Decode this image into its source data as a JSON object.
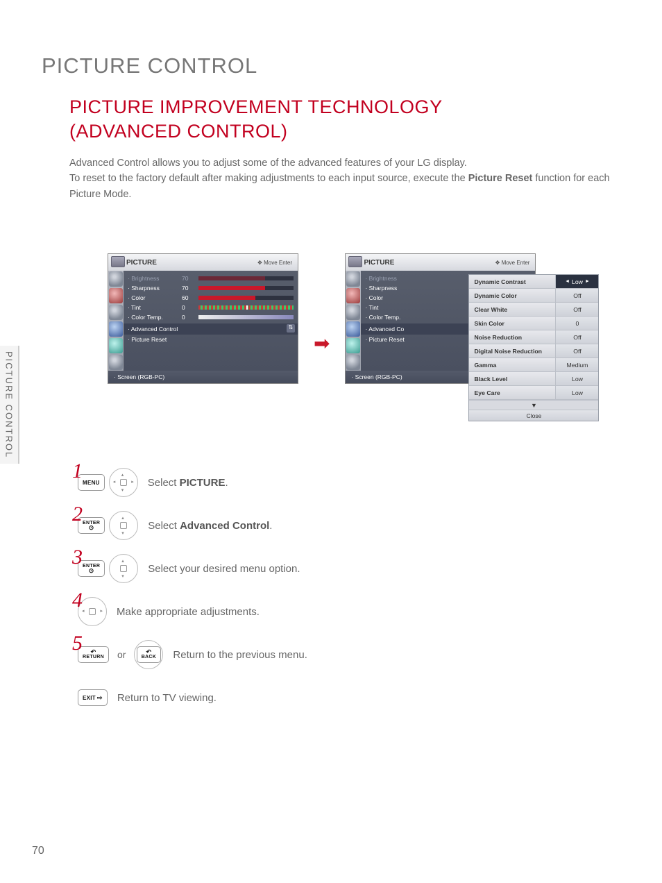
{
  "sideTab": "PICTURE CONTROL",
  "pageTitle": "PICTURE CONTROL",
  "subtitleLine1": "PICTURE IMPROVEMENT TECHNOLOGY",
  "subtitleLine2": "(ADVANCED CONTROL)",
  "intro": {
    "p1": "Advanced Control allows you to adjust some of the advanced features of your LG display.",
    "p2a": "To reset to the factory default after making adjustments to each input source, execute the ",
    "p2b": "Picture Reset",
    "p2c": " function for each Picture Mode."
  },
  "osd": {
    "title": "PICTURE",
    "headerHint": "Move    Enter",
    "items": {
      "brightness": "· Brightness",
      "sharpness": "· Sharpness",
      "color": "· Color",
      "tint": "· Tint",
      "colorTemp": "· Color Temp.",
      "advanced": "· Advanced Control",
      "advancedShort": "· Advanced Co",
      "pictureReset": "· Picture Reset",
      "screen": "· Screen (RGB-PC)"
    },
    "vals": {
      "brightness": "70",
      "sharpness": "70",
      "color": "60",
      "tint": "0",
      "colorTemp": "0"
    }
  },
  "popup": {
    "rows": [
      {
        "label": "Dynamic Contrast",
        "value": "Low",
        "selected": true
      },
      {
        "label": "Dynamic Color",
        "value": "Off"
      },
      {
        "label": "Clear White",
        "value": "Off"
      },
      {
        "label": "Skin Color",
        "value": "0"
      },
      {
        "label": "Noise Reduction",
        "value": "Off"
      },
      {
        "label": "Digital Noise Reduction",
        "value": "Off"
      },
      {
        "label": "Gamma",
        "value": "Medium"
      },
      {
        "label": "Black Level",
        "value": "Low"
      },
      {
        "label": "Eye Care",
        "value": "Low"
      }
    ],
    "more": "▼",
    "close": "Close"
  },
  "buttons": {
    "menu": "MENU",
    "enter": "ENTER",
    "return": "RETURN",
    "back": "BACK",
    "exit": "EXIT"
  },
  "steps": {
    "s1": {
      "n": "1",
      "a": "Select ",
      "b": "PICTURE",
      "c": "."
    },
    "s2": {
      "n": "2",
      "a": "Select ",
      "b": "Advanced Control",
      "c": "."
    },
    "s3": {
      "n": "3",
      "t": "Select your desired menu option."
    },
    "s4": {
      "n": "4",
      "t": "Make appropriate adjustments."
    },
    "s5": {
      "n": "5",
      "or": "or",
      "t": "Return to the previous menu."
    },
    "s6": {
      "t": "Return to TV viewing."
    }
  },
  "pageNumber": "70"
}
